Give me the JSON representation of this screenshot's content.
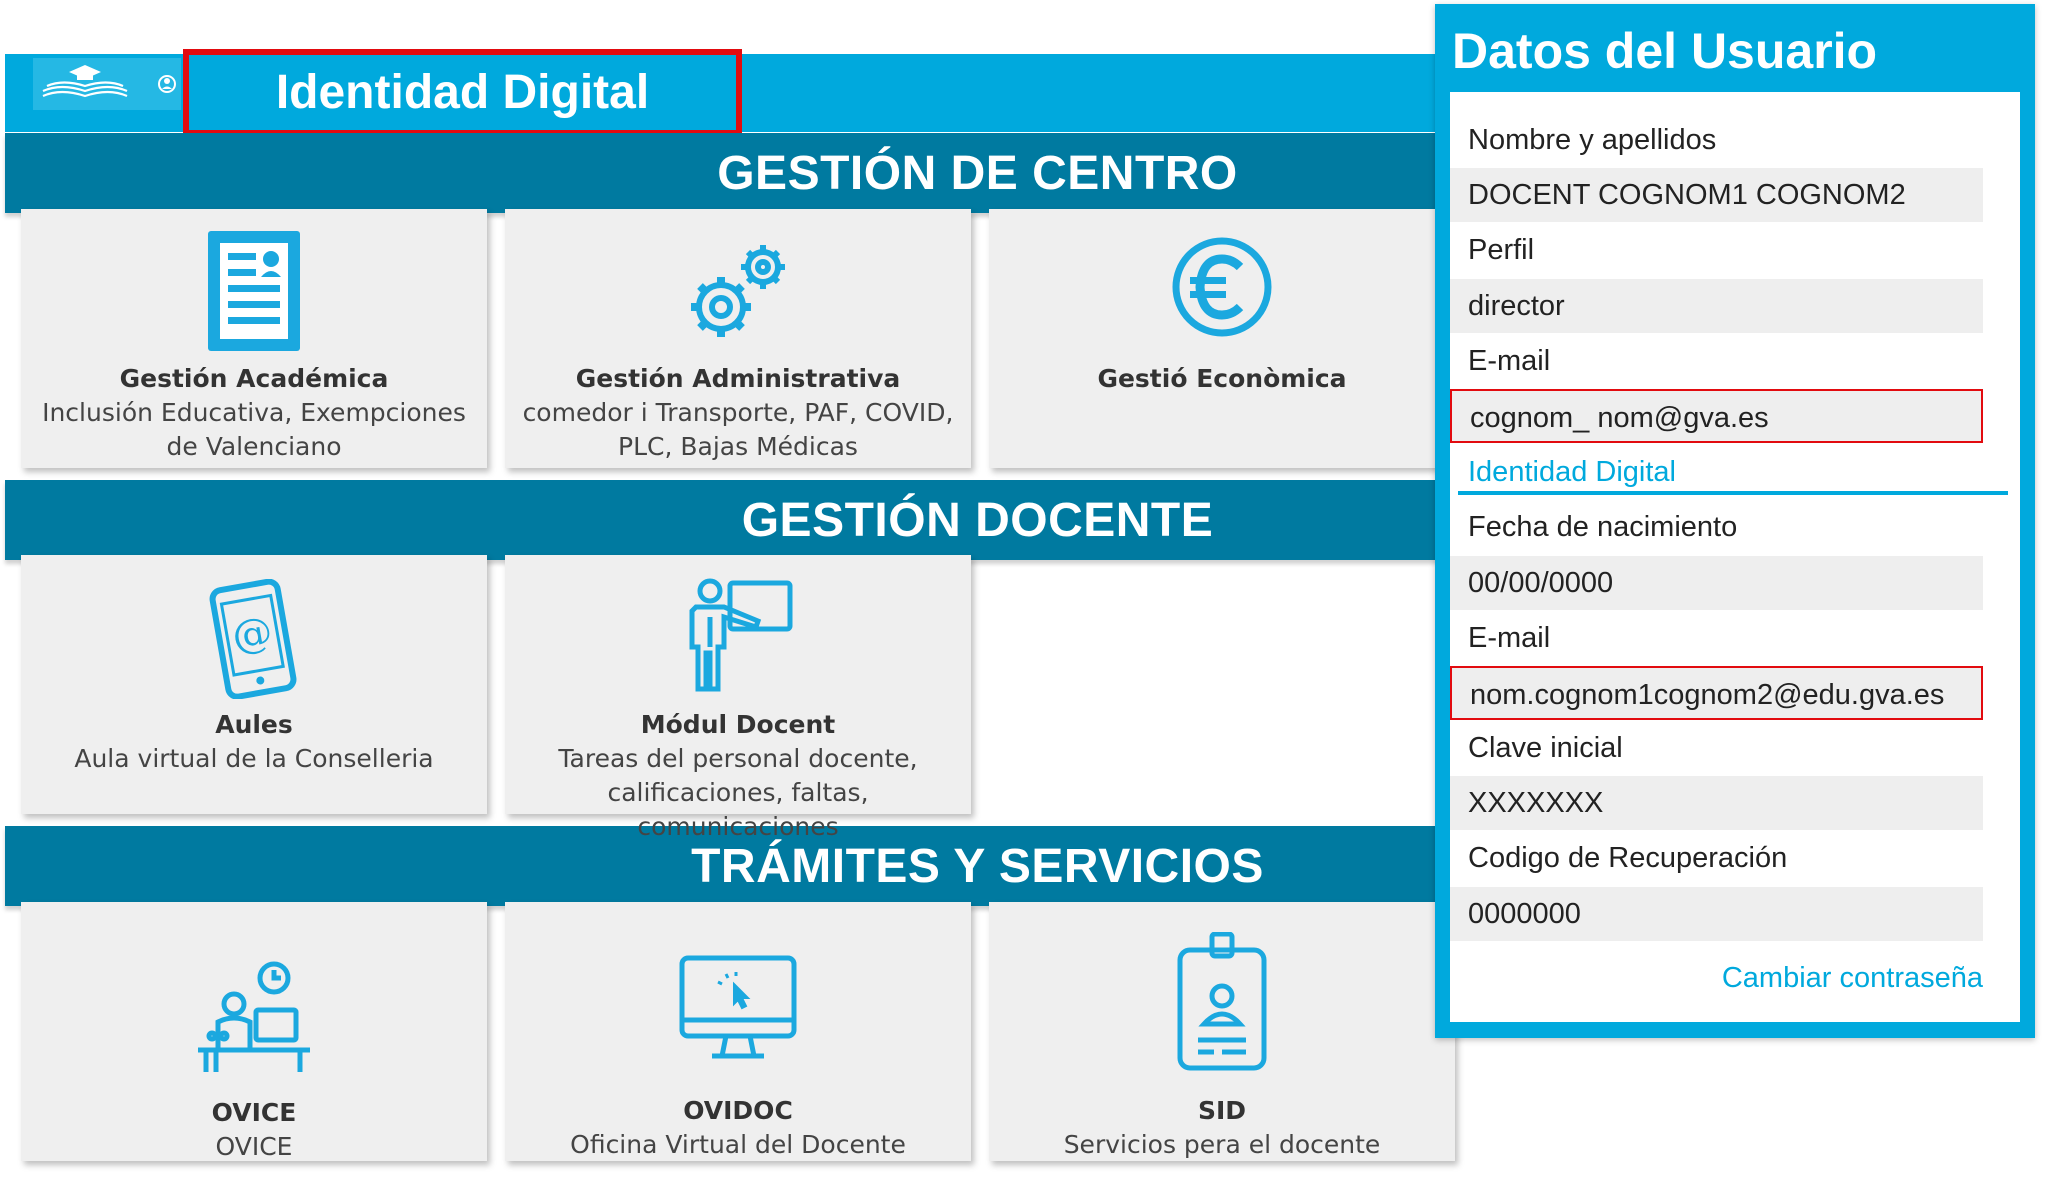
{
  "header": {
    "title": "Identidad Digital"
  },
  "sections": {
    "centro": "GESTIÓN DE CENTRO",
    "docente": "GESTIÓN DOCENTE",
    "tramites": "TRÁMITES Y SERVICIOS"
  },
  "tiles": [
    {
      "title": "Gestión Académica",
      "desc": "Inclusión Educativa, Exempciones de Valenciano",
      "icon": "document-icon"
    },
    {
      "title": "Gestión Administrativa",
      "desc": "comedor i Transporte, PAF, COVID, PLC, Bajas Médicas",
      "icon": "gears-icon"
    },
    {
      "title": "Gestió Econòmica",
      "desc": "",
      "icon": "euro-icon"
    },
    {
      "title": "Aules",
      "desc": "Aula virtual de la Conselleria",
      "icon": "tablet-at-icon"
    },
    {
      "title": "Módul Docent",
      "desc": "Tareas del personal docente, calificaciones, faltas, comunicaciones",
      "icon": "teacher-icon"
    },
    {
      "title": "OVICE",
      "desc": "OVICE",
      "icon": "office-clock-icon"
    },
    {
      "title": "OVIDOC",
      "desc": "Oficina Virtual del Docente",
      "icon": "monitor-icon"
    },
    {
      "title": "SID",
      "desc": "Servicios pera el docente",
      "icon": "badge-icon"
    }
  ],
  "panel": {
    "title": "Datos del Usuario",
    "name_label": "Nombre y apellidos",
    "name_value": "DOCENT COGNOM1 COGNOM2",
    "profile_label": "Perfil",
    "profile_value": "director",
    "email_label": "E-mail",
    "email_value": "cognom_ nom@gva.es",
    "id_heading": "Identidad Digital",
    "birth_label": "Fecha de nacimiento",
    "birth_value": "00/00/0000",
    "email2_label": "E-mail",
    "email2_value": "nom.cognom1cognom2@edu.gva.es",
    "key_label": "Clave inicial",
    "key_value": "XXXXXXX",
    "recovery_label": "Codigo de Recuperación",
    "recovery_value": "0000000",
    "change_password": "Cambiar contraseña"
  },
  "colors": {
    "accent": "#00a9dd",
    "section": "#007aa0",
    "highlight": "#e20b0f",
    "icon": "#1ba8df"
  }
}
